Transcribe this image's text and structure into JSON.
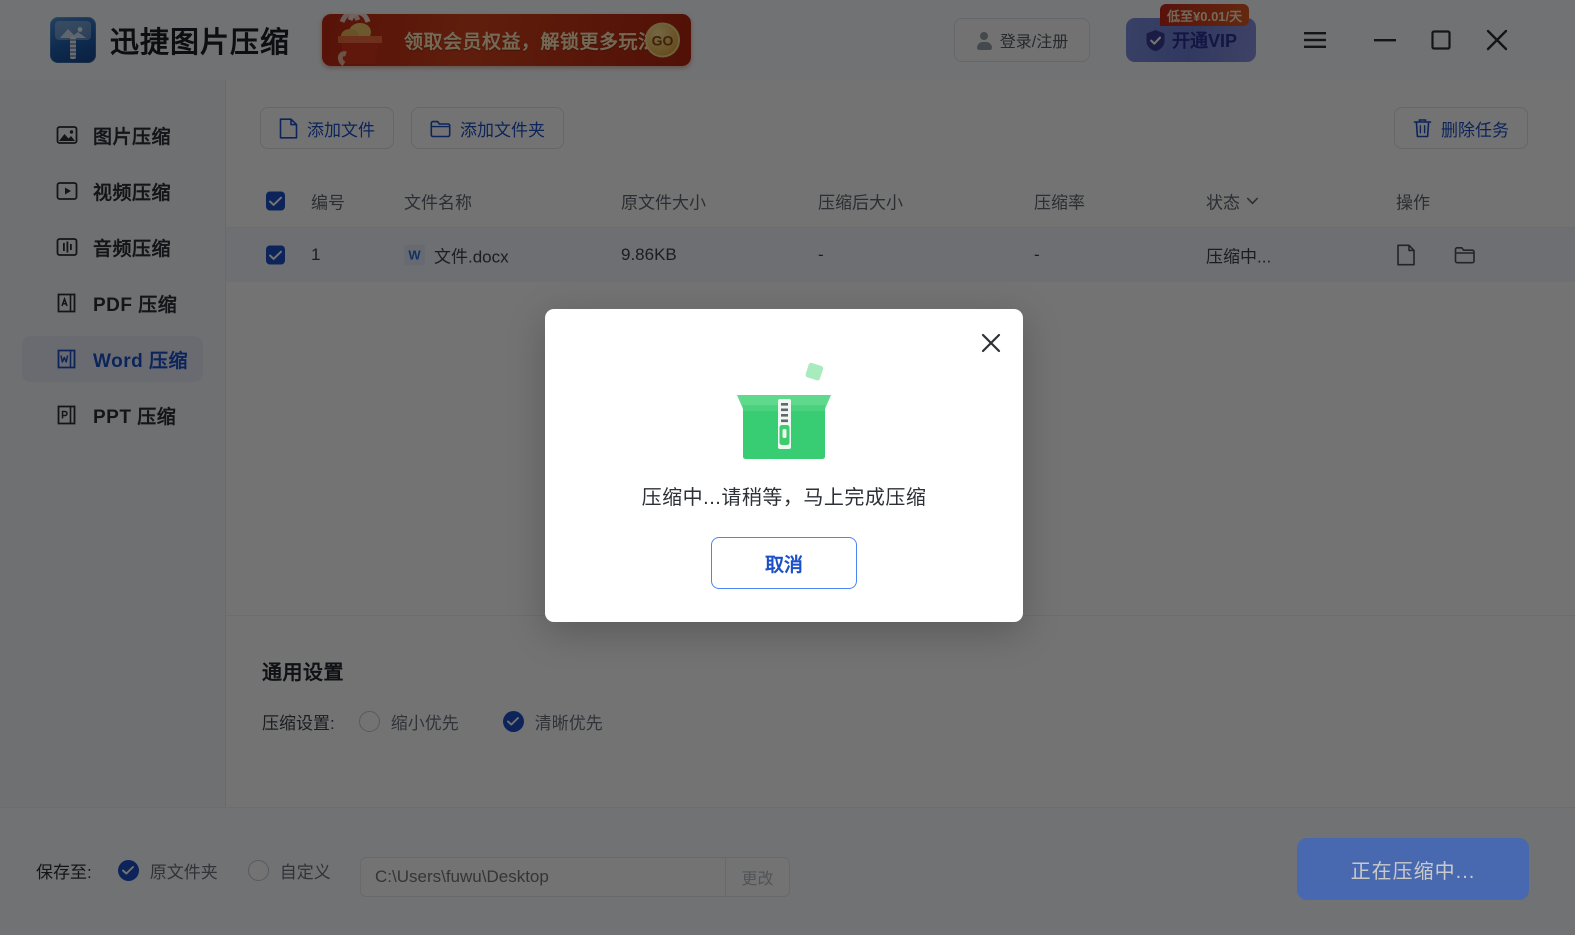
{
  "app": {
    "title": "迅捷图片压缩",
    "logo_icon": "compress-box-logo"
  },
  "promo": {
    "text": "领取会员权益，解锁更多玩法",
    "go_label": "GO",
    "icon": "red-envelope-pot-icon"
  },
  "titlebar": {
    "login_label": "登录/注册",
    "login_icon": "user-avatar-icon",
    "vip_label": "开通VIP",
    "vip_icon": "shield-check-icon",
    "vip_badge": "低至¥0.01/天",
    "menu_icon": "hamburger-menu-icon",
    "minimize_icon": "minimize-icon",
    "maximize_icon": "maximize-icon",
    "close_icon": "close-icon"
  },
  "sidebar": {
    "items": [
      {
        "label": "图片压缩",
        "icon": "image-icon",
        "active": false
      },
      {
        "label": "视频压缩",
        "icon": "video-play-icon",
        "active": false
      },
      {
        "label": "音频压缩",
        "icon": "audio-wave-icon",
        "active": false
      },
      {
        "label": "PDF 压缩",
        "icon": "pdf-file-icon",
        "active": false
      },
      {
        "label": "Word 压缩",
        "icon": "word-file-icon",
        "active": true
      },
      {
        "label": "PPT 压缩",
        "icon": "ppt-file-icon",
        "active": false
      }
    ]
  },
  "toolbar": {
    "add_file_label": "添加文件",
    "add_file_icon": "file-icon",
    "add_folder_label": "添加文件夹",
    "add_folder_icon": "folder-icon",
    "delete_task_label": "删除任务",
    "delete_task_icon": "trash-icon"
  },
  "table": {
    "headers": {
      "num": "编号",
      "name": "文件名称",
      "orig_size": "原文件大小",
      "compressed_size": "压缩后大小",
      "rate": "压缩率",
      "status": "状态",
      "action": "操作"
    },
    "header_checked": true,
    "status_sort_icon": "chevron-down-icon",
    "rows": [
      {
        "checked": true,
        "num": "1",
        "name": "文件.docx",
        "file_badge": "W",
        "orig_size": "9.86KB",
        "compressed_size": "-",
        "rate": "-",
        "status": "压缩中...",
        "action_preview_icon": "file-icon",
        "action_folder_icon": "folder-open-icon"
      }
    ]
  },
  "settings": {
    "title": "通用设置",
    "compress_label": "压缩设置:",
    "options": [
      {
        "label": "缩小优先",
        "selected": false
      },
      {
        "label": "清晰优先",
        "selected": true
      }
    ]
  },
  "bottom": {
    "save_to_label": "保存至:",
    "options": [
      {
        "label": "原文件夹",
        "selected": true
      },
      {
        "label": "自定义",
        "selected": false
      }
    ],
    "path_value": "C:\\Users\\fuwu\\Desktop",
    "path_placeholder": "C:\\Users\\fuwu\\Desktop",
    "change_label": "更改",
    "cta_label": "正在压缩中..."
  },
  "modal": {
    "message": "压缩中...请稍等，马上完成压缩",
    "cancel_label": "取消",
    "close_icon": "close-icon",
    "art_icon": "green-zip-box-icon"
  },
  "colors": {
    "accent": "#1b50c8",
    "cta": "#2f63d6",
    "promo_red": "#c02a12",
    "vip_purple": "#7f8fe0",
    "zip_green": "#3fcc6f",
    "overlay": "rgba(0,0,0,0.55)"
  }
}
